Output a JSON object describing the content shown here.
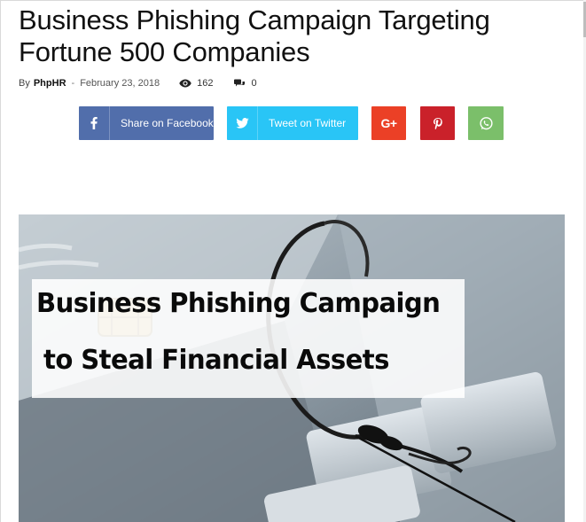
{
  "article": {
    "title": "Business Phishing Campaign Targeting Fortune 500 Companies",
    "meta": {
      "by_label": "By",
      "author": "PhpHR",
      "separator": "-",
      "date": "February 23, 2018",
      "views": "162",
      "comments": "0"
    }
  },
  "share": {
    "facebook_label": "Share on Facebook",
    "twitter_label": "Tweet on Twitter",
    "googleplus_icon": "G+",
    "colors": {
      "facebook": "#516eab",
      "twitter": "#29c5f6",
      "googleplus": "#eb4026",
      "pinterest": "#ca212a",
      "whatsapp": "#7bbf6a"
    }
  },
  "hero": {
    "caption_line_1": "Business Phishing Campaign",
    "caption_line_2": "to Steal Financial Assets"
  },
  "icons": {
    "views": "eye-icon",
    "comments": "comment-icon",
    "facebook": "facebook-icon",
    "twitter": "twitter-icon",
    "googleplus": "google-plus-icon",
    "pinterest": "pinterest-icon",
    "whatsapp": "whatsapp-icon"
  }
}
